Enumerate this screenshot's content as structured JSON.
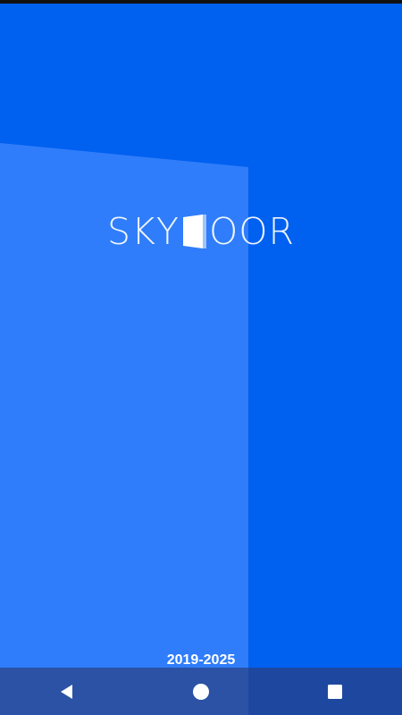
{
  "app": {
    "logo_left": "SKY",
    "logo_right": "OOR",
    "years": "2019-2025"
  },
  "navbar": {
    "back_icon": "back-triangle-icon",
    "home_icon": "home-circle-icon",
    "recents_icon": "recents-square-icon"
  },
  "colors": {
    "background": "#0060F0",
    "panel": "#2F7DFA",
    "navbar": "#1E48A0",
    "text": "#FFFFFF"
  }
}
